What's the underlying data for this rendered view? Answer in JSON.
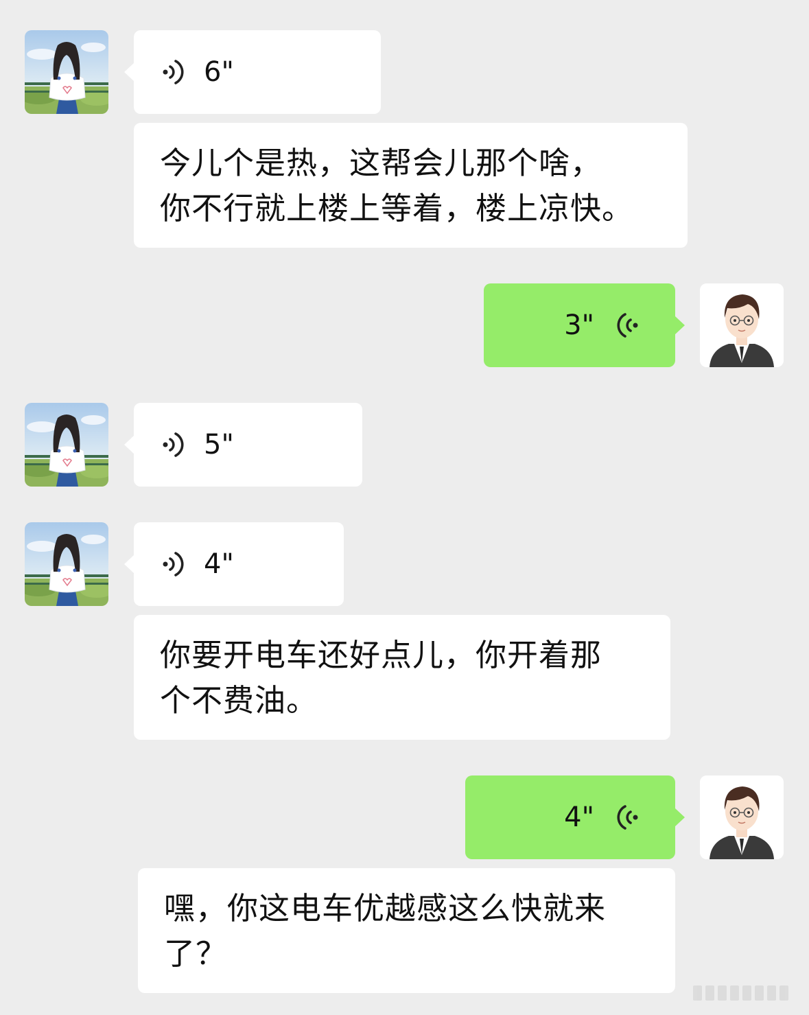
{
  "messages": [
    {
      "from": "left",
      "type": "voice",
      "duration": "6\""
    },
    {
      "from": "left",
      "type": "transcript",
      "text": "今儿个是热，这帮会儿那个啥，\n你不行就上楼上等着，楼上凉快。"
    },
    {
      "from": "right",
      "type": "voice",
      "duration": "3\""
    },
    {
      "from": "left",
      "type": "voice",
      "duration": "5\""
    },
    {
      "from": "left",
      "type": "voice",
      "duration": "4\""
    },
    {
      "from": "left",
      "type": "transcript",
      "text": "你要开电车还好点儿，你开着那\n个不费油。"
    },
    {
      "from": "right",
      "type": "voice",
      "duration": "4\""
    },
    {
      "from": "right",
      "type": "transcript",
      "text": "嘿，你这电车优越感这么快就来\n了？"
    }
  ],
  "avatars": {
    "left": "girl-avatar",
    "right": "boy-avatar"
  },
  "colors": {
    "background": "#ededed",
    "incoming_bubble": "#ffffff",
    "outgoing_bubble": "#95ec69"
  }
}
